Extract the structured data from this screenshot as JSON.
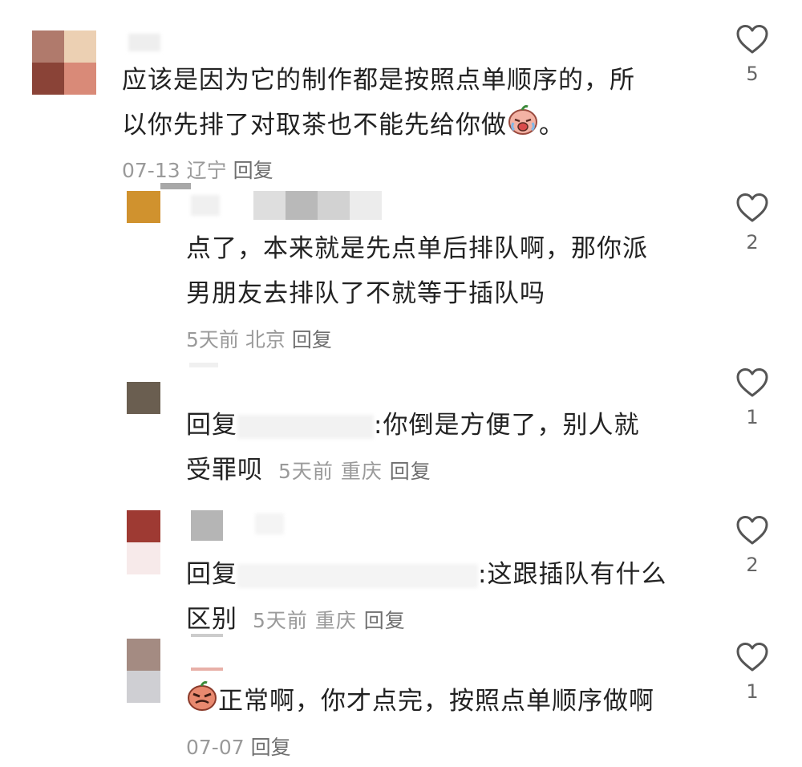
{
  "comments": [
    {
      "text_line1": "应该是因为它的制作都是按照点单顺序的，所",
      "text_line2": "以你先排了对取茶也不能先给你做",
      "text_tail": "。",
      "date": "07-13",
      "location": "辽宁",
      "reply_label": "回复",
      "likes": "5",
      "emoji": "crying-face"
    },
    {
      "text_line1": "点了，本来就是先点单后排队啊，那你派",
      "text_line2": "男朋友去排队了不就等于插队吗",
      "date": "5天前",
      "location": "北京",
      "reply_label": "回复",
      "likes": "2"
    },
    {
      "reply_prefix": "回复",
      "text_line1": ":你倒是方便了，别人就",
      "text_line2": "受罪呗",
      "date": "5天前",
      "location": "重庆",
      "reply_label": "回复",
      "likes": "1"
    },
    {
      "reply_prefix": "回复",
      "text_line1": ":这跟插队有什么",
      "text_line2": "区别",
      "date": "5天前",
      "location": "重庆",
      "reply_label": "回复",
      "likes": "2"
    },
    {
      "text_line1": "正常啊，你才点完，按照点单顺序做啊",
      "date": "07-07",
      "reply_label": "回复",
      "likes": "1",
      "emoji": "grumpy-face"
    }
  ],
  "colors": {
    "text": "#222222",
    "meta": "#9a9a9a",
    "icon": "#555555"
  }
}
